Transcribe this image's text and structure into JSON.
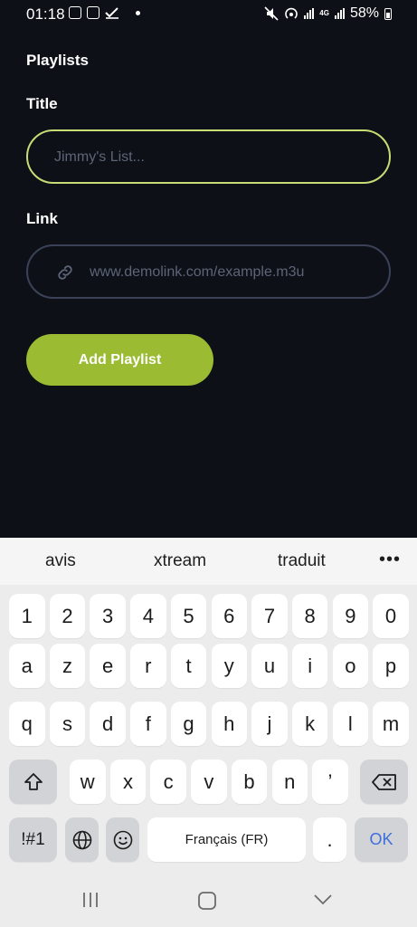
{
  "status_bar": {
    "time": "01:18",
    "battery": "58%",
    "network": "4G"
  },
  "form": {
    "section_title": "Playlists",
    "title_label": "Title",
    "title_placeholder": "Jimmy's List...",
    "link_label": "Link",
    "link_placeholder": "www.demolink.com/example.m3u",
    "add_button": "Add Playlist",
    "colors": {
      "background": "#0d1117",
      "accent": "#9bbb33",
      "focus_border": "#c6dd76"
    }
  },
  "keyboard": {
    "suggestions": [
      "avis",
      "xtream",
      "traduit"
    ],
    "more": "•••",
    "row_numbers": [
      "1",
      "2",
      "3",
      "4",
      "5",
      "6",
      "7",
      "8",
      "9",
      "0"
    ],
    "row1": [
      "a",
      "z",
      "e",
      "r",
      "t",
      "y",
      "u",
      "i",
      "o",
      "p"
    ],
    "row2": [
      "q",
      "s",
      "d",
      "f",
      "g",
      "h",
      "j",
      "k",
      "l",
      "m"
    ],
    "row3": [
      "w",
      "x",
      "c",
      "v",
      "b",
      "n",
      "’"
    ],
    "symbols_key": "!#1",
    "space_label": "Français (FR)",
    "period_key": ".",
    "ok_key": "OK"
  }
}
